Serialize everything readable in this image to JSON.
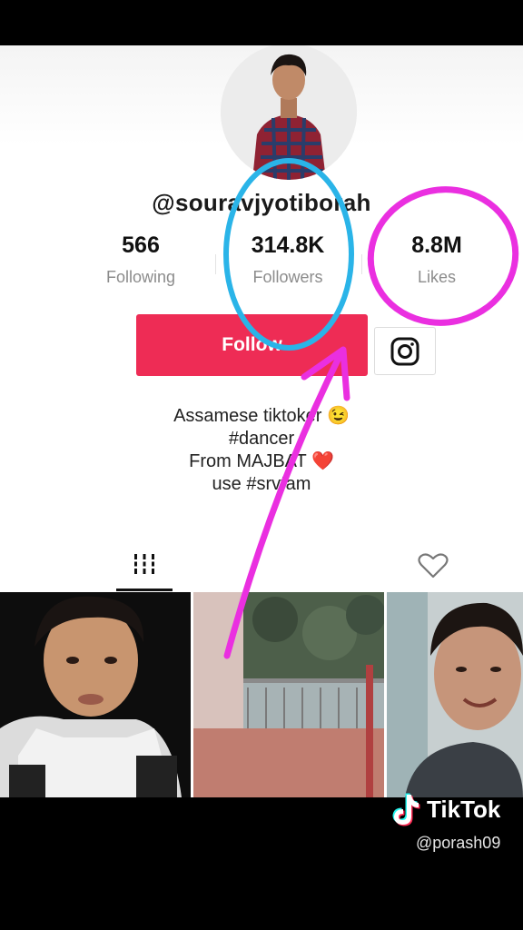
{
  "profile": {
    "username": "@souravjyotiborah",
    "stats": [
      {
        "value": "566",
        "label": "Following"
      },
      {
        "value": "314.8K",
        "label": "Followers"
      },
      {
        "value": "8.8M",
        "label": "Likes"
      }
    ],
    "follow_label": "Follow",
    "bio": [
      "Assamese tiktoker 😉",
      "#dancer",
      "From MAJBAT ❤️",
      "use #srvfam"
    ]
  },
  "tabs": {
    "videos_icon": "grid-icon",
    "liked_icon": "heart-outline-icon"
  },
  "watermark": {
    "brand": "TikTok",
    "handle": "@porash09"
  },
  "colors": {
    "follow_button": "#ee2c55",
    "circle_followers": "#2ab4e8",
    "circle_likes": "#ea2fe0",
    "arrow": "#ea2fe0"
  }
}
